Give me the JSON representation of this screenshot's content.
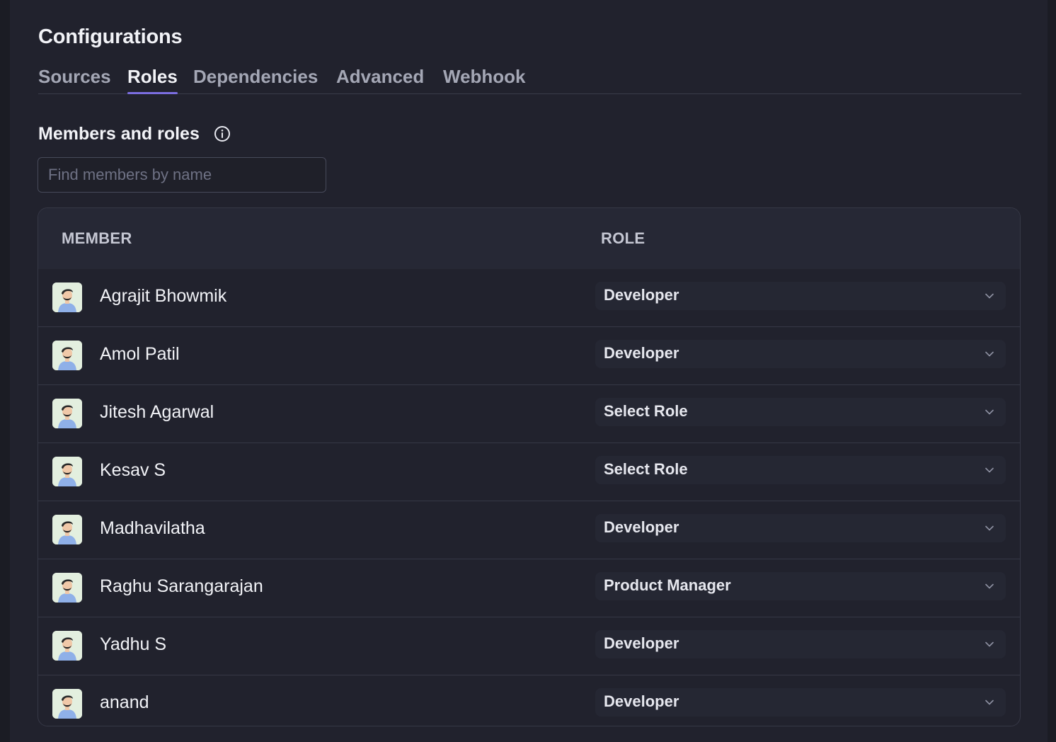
{
  "page": {
    "title": "Configurations"
  },
  "tabs": [
    {
      "label": "Sources",
      "active": false
    },
    {
      "label": "Roles",
      "active": true
    },
    {
      "label": "Dependencies",
      "active": false
    },
    {
      "label": "Advanced",
      "active": false
    },
    {
      "label": "Webhook",
      "active": false
    }
  ],
  "section": {
    "title": "Members and roles",
    "info_icon": "info-circle-icon"
  },
  "search": {
    "placeholder": "Find members by name",
    "value": ""
  },
  "table": {
    "headers": {
      "member": "MEMBER",
      "role": "ROLE"
    },
    "rows": [
      {
        "name": "Agrajit Bhowmik",
        "role": "Developer"
      },
      {
        "name": "Amol Patil",
        "role": "Developer"
      },
      {
        "name": "Jitesh Agarwal",
        "role": "Select Role"
      },
      {
        "name": "Kesav S",
        "role": "Select Role"
      },
      {
        "name": "Madhavilatha",
        "role": "Developer"
      },
      {
        "name": "Raghu Sarangarajan",
        "role": "Product Manager"
      },
      {
        "name": "Yadhu S",
        "role": "Developer"
      },
      {
        "name": "anand",
        "role": "Developer"
      }
    ]
  },
  "colors": {
    "accent": "#7b6ee0",
    "background": "#21222d",
    "header_bg": "#262835"
  }
}
